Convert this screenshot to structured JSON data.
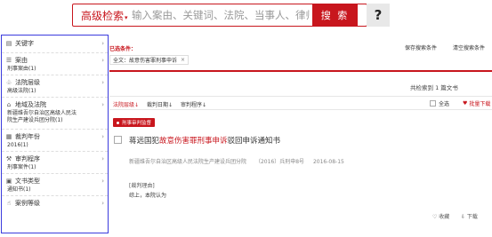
{
  "search": {
    "advanced_label": "高级检索",
    "placeholder": "输入案由、关键词、法院、当事人、律师",
    "button_label": "搜 索",
    "help_label": "?"
  },
  "filters": [
    {
      "icon": "document-icon",
      "label": "关键字",
      "sub": []
    },
    {
      "icon": "list-icon",
      "label": "案由",
      "sub": [
        "刑事案由(1)"
      ]
    },
    {
      "icon": "court-hierarchy-icon",
      "label": "法院层级",
      "sub": [
        "高级法院(1)"
      ]
    },
    {
      "icon": "court-building-icon",
      "label": "地域及法院",
      "sub": [
        "新疆维吾尔自治区高级人民法",
        "院生产建设兵团分院(1)"
      ]
    },
    {
      "icon": "calendar-icon",
      "label": "裁判年份",
      "sub": [
        "2016(1)"
      ]
    },
    {
      "icon": "gavel-icon",
      "label": "审判程序",
      "sub": [
        "刑事案件(1)"
      ]
    },
    {
      "icon": "file-type-icon",
      "label": "文书类型",
      "sub": [
        "通知书(1)"
      ]
    },
    {
      "icon": "thumb-icon",
      "label": "案例等级",
      "sub": []
    }
  ],
  "conditions": {
    "label": "已选条件：",
    "save_label": "保存搜索条件",
    "clear_label": "清空搜索条件",
    "chip_label": "全文：故意伤害罪刑事申诉",
    "chip_close": "×"
  },
  "results": {
    "count_text": "共检索到 1 篇文书"
  },
  "sort": {
    "level": "法院层级↓",
    "date": "裁判日期↓",
    "procedure": "审判程序↓",
    "select_all": "全选",
    "batch_download": "批量下载"
  },
  "card": {
    "badge": "刑事审判监督",
    "title_prefix": "蒋远国犯",
    "title_highlight": "故意伤害罪刑事申诉",
    "title_suffix": "驳回申诉通知书",
    "court": "新疆维吾尔自治区高级人民法院生产建设兵团分院",
    "case_no": "（2016）兵刑申8号",
    "date": "2016-08-15",
    "reason_label": "[裁判理由]",
    "reason_text": "综上，本院认为",
    "collect": "♡ 收藏",
    "download": "⇩ 下载"
  },
  "colors": {
    "accent": "#c8161d",
    "panel_border": "#3b3bdd"
  }
}
